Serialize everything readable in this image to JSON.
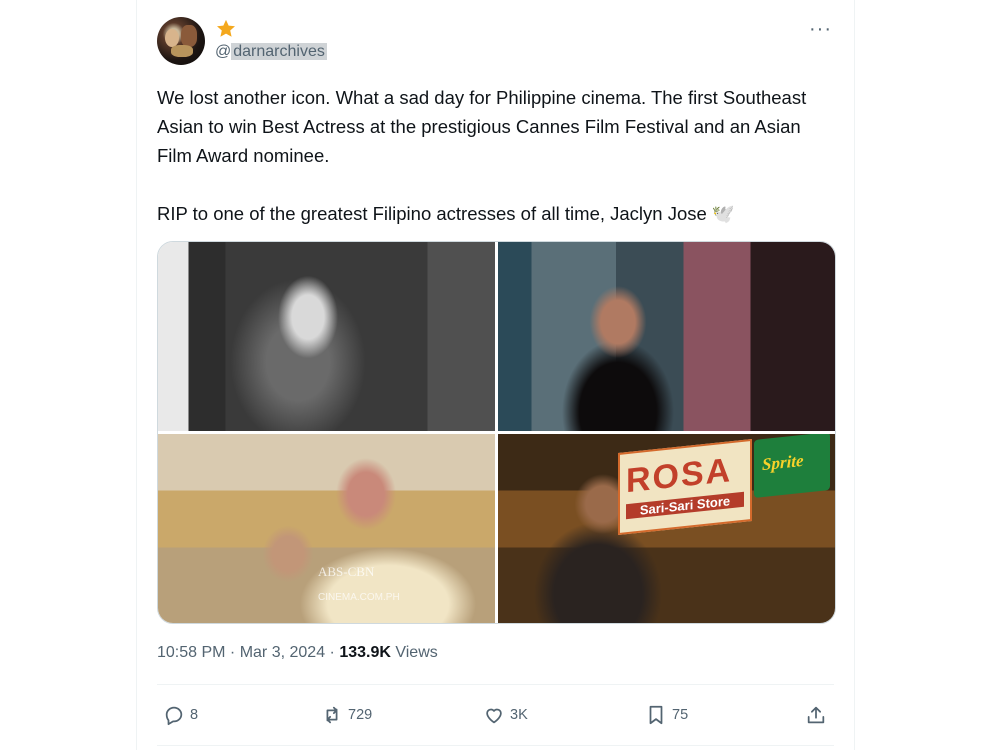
{
  "post": {
    "handle_prefix": "@",
    "handle_name": "darnarchives",
    "more_glyph": "···",
    "text_p1": "We lost another icon. What a sad day for Philippine cinema. The first Southeast Asian to win Best Actress at the prestigious Cannes Film Festival and an Asian Film Award nominee.",
    "text_p2": "RIP to one of the greatest Filipino actresses of all time, Jaclyn Jose 🕊️",
    "time": "10:58 PM",
    "sep1": " · ",
    "date": "Mar 3, 2024",
    "sep2": " · ",
    "views_count": "133.9K",
    "views_label": " Views"
  },
  "media": {
    "sign_top": "ROSA",
    "sign_bottom": "Sari-Sari Store",
    "sprite_text": "Sprite",
    "watermark": "ABS-CBN",
    "watermark_url": "CINEMA.COM.PH"
  },
  "actions": {
    "reply_count": "8",
    "repost_count": "729",
    "like_count": "3K",
    "bookmark_count": "75"
  },
  "colors": {
    "text": "#0f1419",
    "muted": "#536471",
    "border": "#eff3f4",
    "star": "#f4a81d"
  },
  "icons": [
    "star-icon",
    "more-icon",
    "reply-icon",
    "repost-icon",
    "like-icon",
    "bookmark-icon",
    "share-icon"
  ]
}
